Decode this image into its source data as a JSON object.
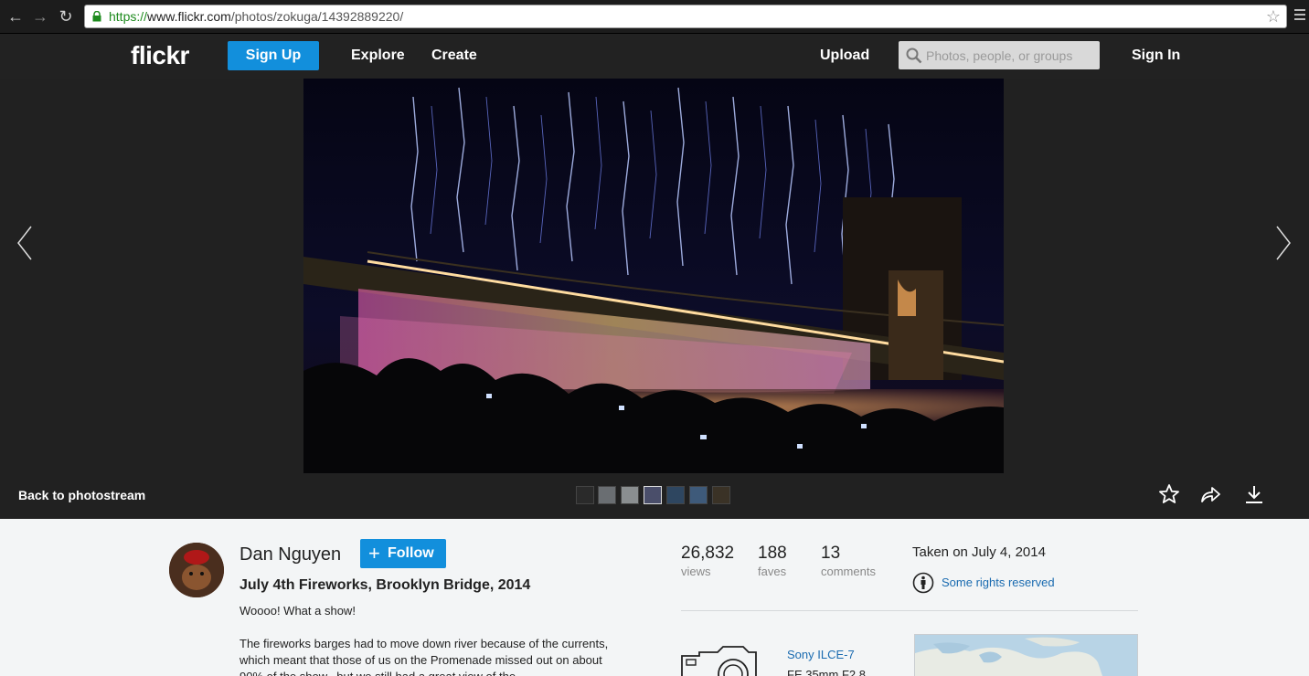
{
  "browser": {
    "url_scheme": "https://",
    "url_host": "www.flickr.com",
    "url_path": "/photos/zokuga/14392889220/",
    "back_icon": "arrow-left-icon",
    "forward_icon": "arrow-right-icon",
    "reload_icon": "reload-icon",
    "bookmark_icon": "star-icon"
  },
  "header": {
    "logo": "flickr",
    "signup_label": "Sign Up",
    "explore_label": "Explore",
    "create_label": "Create",
    "upload_label": "Upload",
    "search_placeholder": "Photos, people, or groups",
    "signin_label": "Sign In",
    "accent_color": "#128fdc"
  },
  "stage": {
    "back_label": "Back to photostream",
    "thumbnail_count": 7,
    "active_thumbnail": 4
  },
  "photo": {
    "owner": "Dan Nguyen",
    "follow_label": "Follow",
    "title": "July 4th Fireworks, Brooklyn Bridge, 2014",
    "description_line1": "Woooo! What a show!",
    "description_para": "The fireworks barges had to move down river because of the currents, which meant that those of us on the Promenade missed out on about 90% of the show...but we still had a great view of the"
  },
  "stats": {
    "views": "26,832",
    "views_label": "views",
    "faves": "188",
    "faves_label": "faves",
    "comments": "13",
    "comments_label": "comments",
    "taken": "Taken on July 4, 2014",
    "rights": "Some rights reserved"
  },
  "exif": {
    "camera": "Sony ILCE-7",
    "lens": "FE 35mm F2.8"
  }
}
